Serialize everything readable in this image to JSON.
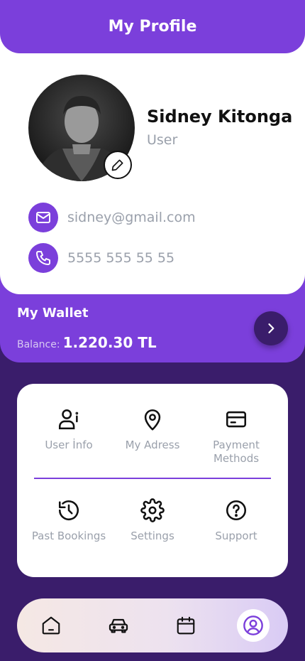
{
  "header": {
    "title": "My Profile"
  },
  "profile": {
    "name": "Sidney Kitonga",
    "role": "User",
    "email": "sidney@gmail.com",
    "phone": "5555 555 55 55"
  },
  "wallet": {
    "title": "My Wallet",
    "balance_label": "Balance:",
    "balance_value": "1.220.30 TL"
  },
  "menu": {
    "user_info": "User İnfo",
    "my_address": "My Adress",
    "payment_methods": "Payment Methods",
    "past_bookings": "Past Bookings",
    "settings": "Settings",
    "support": "Support"
  },
  "nav": {
    "items": [
      "home-icon",
      "car-icon",
      "calendar-icon",
      "profile-icon"
    ],
    "active": "profile-icon"
  },
  "colors": {
    "accent": "#7b3fdb",
    "dark": "#3a1d6b",
    "muted_text": "#9aa0ab"
  }
}
